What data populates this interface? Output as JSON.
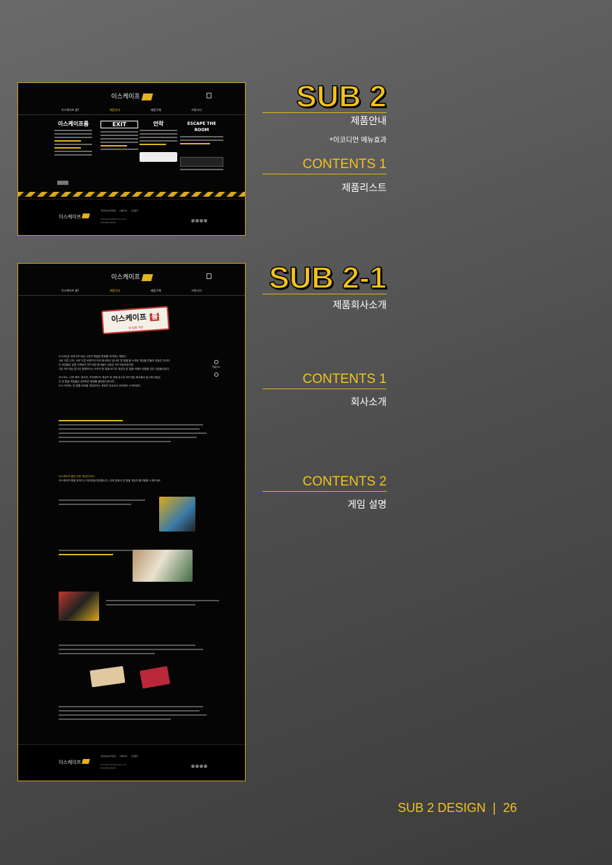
{
  "sub2": {
    "title": "SUB 2",
    "subtitle": "제품안내",
    "note": "*이코디언 메뉴효과",
    "contents1_label": "CONTENTS 1",
    "contents1_desc": "제품리스트"
  },
  "sub2_1": {
    "title": "SUB 2-1",
    "subtitle": "제품회사소개",
    "contents1_label": "CONTENTS 1",
    "contents1_desc": "회사소개",
    "contents2_label": "CONTENTS 2",
    "contents2_desc": "게임 설명"
  },
  "mockup": {
    "logo": "이스케이프",
    "nav": [
      "이스케이프 룸?",
      "제품안내",
      "제품구매",
      "커뮤니티"
    ],
    "brands": [
      "이스케이프룸",
      "EXIT",
      "언락",
      "ESCAPE THE ROOM"
    ],
    "footer_logo": "이스케이프",
    "footer_links": "개인정보처리방침  이용약관  고객센터",
    "footer_info_1": "escaperoom@naver.com",
    "footer_info_2": "ESCAPE ROOM",
    "banner_title": "이스케이프",
    "banner_badge": "룸",
    "banner_sub": "방 탈출 게임",
    "intro_lines": [
      "2016년은 세계 보드게임 시장의 특별한 변화를 의미하는 해였다.",
      "서로 다른 나라, 서로 다른 브랜드의 여러 회사에서 일시에 '방 탈출'을 소재로 게임을 만들어 내놓은 것이다.",
      "이 게임들은 분명 오랫동안 보드게임 회사들이 내놓은 보드게임이었지만,",
      "기존 보드게임 방식과 경향보다는 오히려 방 탈출 비디오 게임과 방 탈출 카페의 영향을 받은 게임들이었다.",
      "코스모스, 디부 퀘즈, 썸코인, 아이덴티티 게임즈 등 세계 유수의 보드게임 회사들이 일시에 내놓은",
      "이 방 탈출 게임들은 세계적인 화제를 불러일으켰으며,",
      "2017년에는 방 탈출 테이블 게임이라는 새로운 장르로서 한국에도 소개되었다."
    ],
    "q_title": "이스케이프 룸은 어떤 게임인가요?",
    "q_desc": "이스케이프 룸을 찾아주신 여러분을 환영합니다. 이제 집에서 방 탈출 게임의 즐거움을 느껴보세요",
    "side_label": "제품안내"
  }
}
